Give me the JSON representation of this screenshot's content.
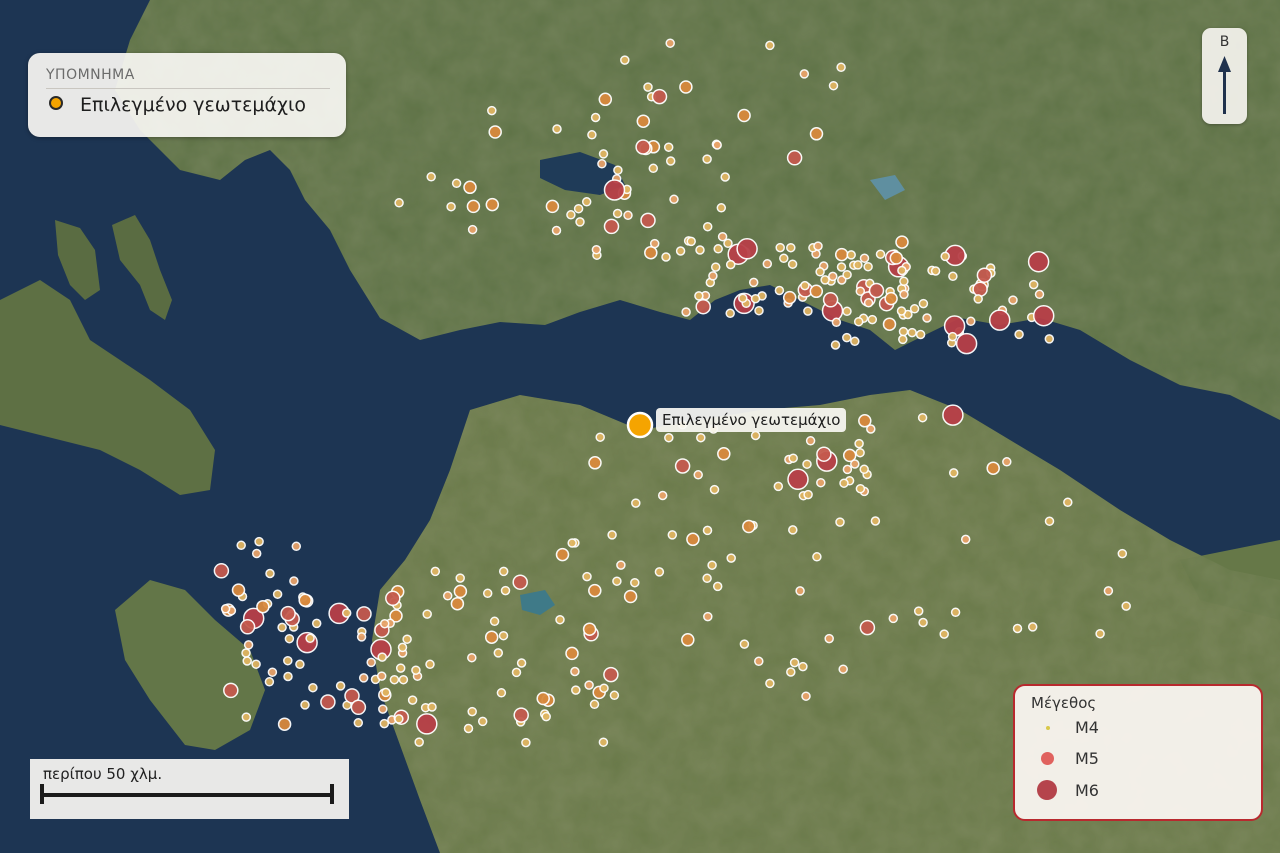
{
  "legend": {
    "title": "ΥΠΟΜΝΗΜΑ",
    "selected_label": "Επιλεγμένο γεωτεμάχιο",
    "selected_color": "#f5a400"
  },
  "compass": {
    "north_letter": "Β",
    "icon": "north-arrow-icon"
  },
  "scale": {
    "label": "περίπου 50 χλμ."
  },
  "selected_parcel": {
    "label": "Επιλεγμένο γεωτεμάχιο"
  },
  "magnitude_legend": {
    "title": "Μέγεθος",
    "items": [
      {
        "label": "M4",
        "color": "#d9c84a"
      },
      {
        "label": "M5",
        "color": "#e0625e"
      },
      {
        "label": "M6",
        "color": "#b5444c"
      }
    ]
  },
  "colors": {
    "sea": "#1d3553",
    "land": "#55704a",
    "border": "#b8292e"
  }
}
